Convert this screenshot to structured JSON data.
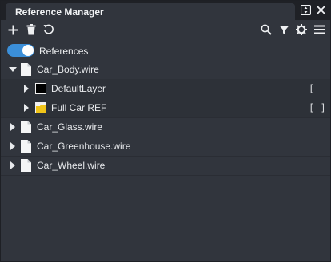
{
  "panel": {
    "title": "Reference Manager"
  },
  "toolbar": {
    "icons": [
      "plus-icon",
      "trash-icon",
      "refresh-icon",
      "search-icon",
      "filter-icon",
      "gear-icon",
      "menu-icon"
    ]
  },
  "references_toggle": {
    "label": "References",
    "enabled": true,
    "color": "#3b8fd9"
  },
  "tree": {
    "items": [
      {
        "label": "Car_Body.wire",
        "expanded": true,
        "children": [
          {
            "label": "DefaultLayer",
            "bracket": "["
          },
          {
            "label": "Full Car REF",
            "bracket": "[ ]"
          }
        ]
      },
      {
        "label": "Car_Glass.wire",
        "expanded": false
      },
      {
        "label": "Car_Greenhouse.wire",
        "expanded": false
      },
      {
        "label": "Car_Wheel.wire",
        "expanded": false
      }
    ]
  }
}
